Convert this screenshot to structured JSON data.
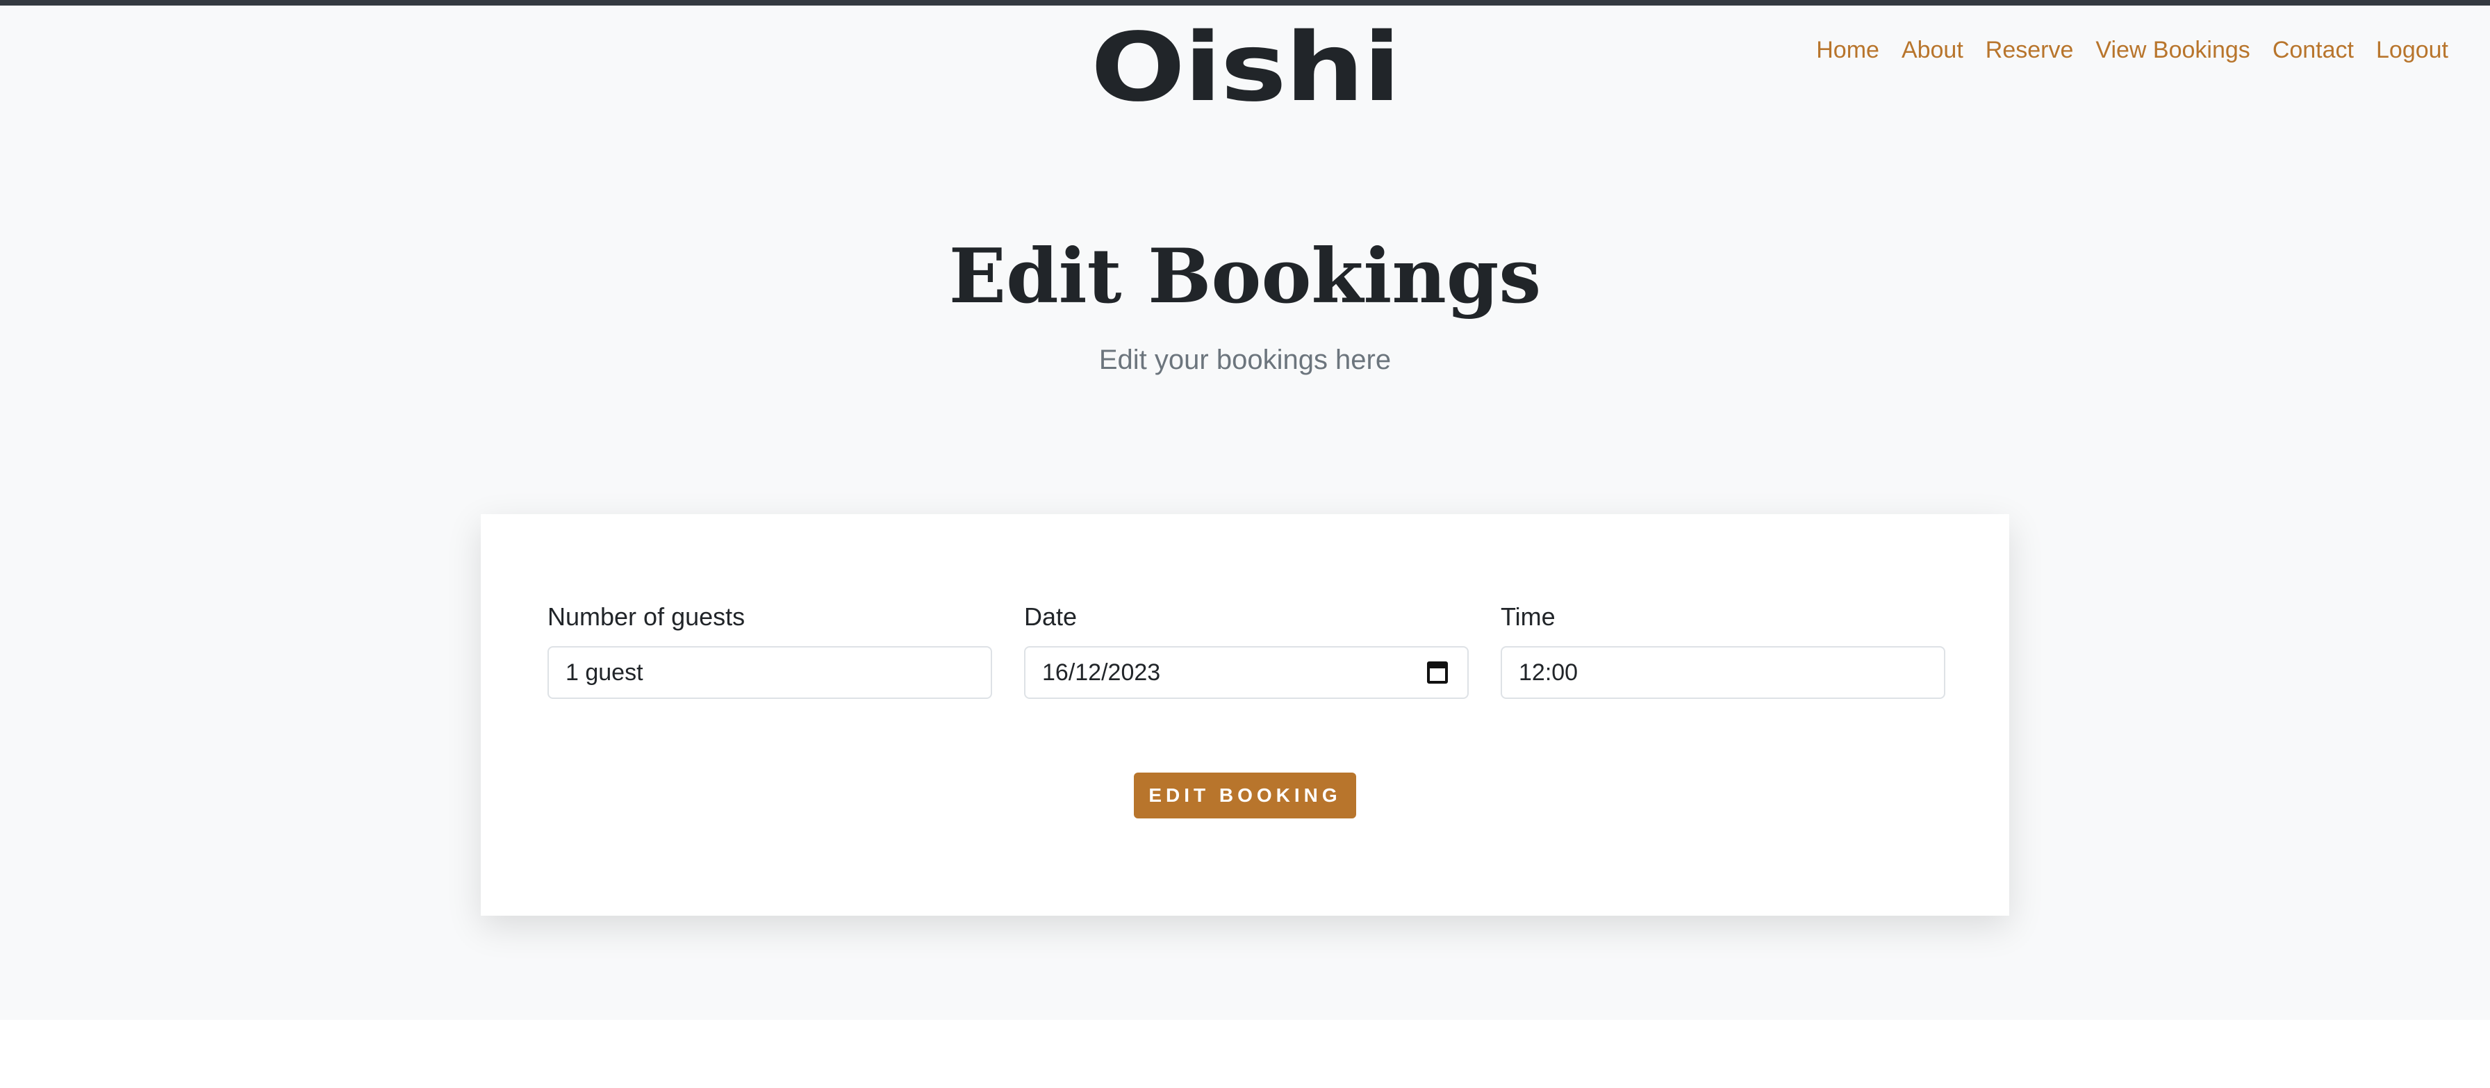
{
  "brand": {
    "name": "Oishi"
  },
  "nav": {
    "items": [
      "Home",
      "About",
      "Reserve",
      "View Bookings",
      "Contact",
      "Logout"
    ],
    "link_color": "#b8752c"
  },
  "hero": {
    "title": "Edit Bookings",
    "subtitle": "Edit your bookings here"
  },
  "form": {
    "guests": {
      "label": "Number of guests",
      "value": "1 guest"
    },
    "date": {
      "label": "Date",
      "value": "16/12/2023",
      "icon": "calendar-icon"
    },
    "time": {
      "label": "Time",
      "value": "12:00"
    },
    "submit_label": "EDIT BOOKING",
    "accent": "#b8752c"
  }
}
